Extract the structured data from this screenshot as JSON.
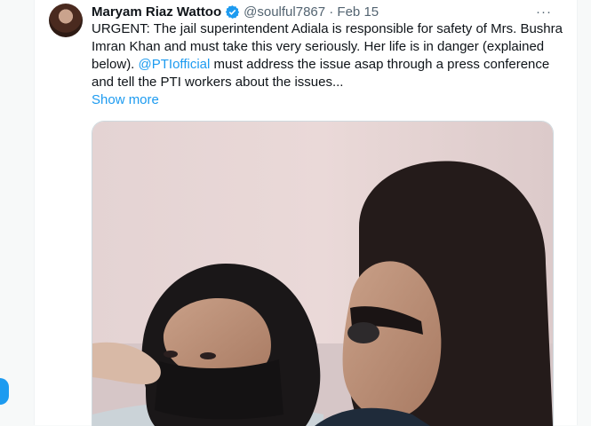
{
  "tweet": {
    "author_name": "Maryam Riaz Wattoo",
    "handle_date": "@soulful7867 · Feb 15",
    "more_label": "···",
    "text_part1": "URGENT: The jail superintendent Adiala is responsible for safety of Mrs. Bushra Imran Khan and must take this very seriously. Her life is in danger (explained below). ",
    "mention": "@PTIofficial",
    "text_part2": "  must address the issue asap through a press conference and tell the PTI workers about the issues...",
    "show_more": "Show more",
    "media": {
      "type": "photo"
    }
  },
  "icons": {
    "verified": "verified-badge-icon",
    "more": "more-options-icon"
  },
  "colors": {
    "accent": "#1d9bf0",
    "text": "#0f1419",
    "secondary": "#536471",
    "background": "#f7f9f9"
  }
}
